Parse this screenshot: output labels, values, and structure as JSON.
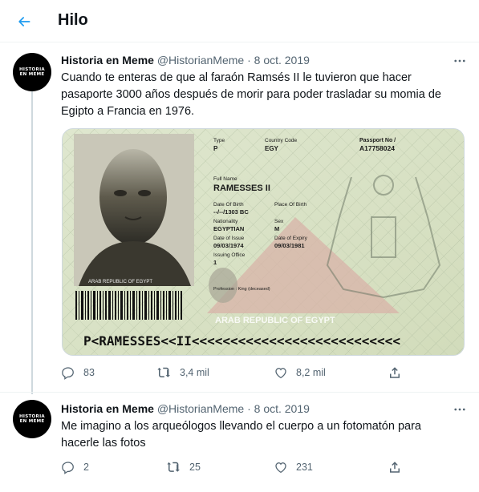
{
  "header": {
    "title": "Hilo"
  },
  "tweets": [
    {
      "name": "Historia en Meme",
      "handle": "@HistorianMeme",
      "sep": "·",
      "date": "8 oct. 2019",
      "text": "Cuando te enteras de que al faraón Ramsés II le tuvieron que hacer pasaporte 3000 años después de morir para poder trasladar su momia de Egipto a Francia en 1976.",
      "avatar_line1": "HISTORIA",
      "avatar_line2": "EN MEME",
      "replies": "83",
      "retweets": "3,4 mil",
      "likes": "8,2 mil"
    },
    {
      "name": "Historia en Meme",
      "handle": "@HistorianMeme",
      "sep": "·",
      "date": "8 oct. 2019",
      "text": "Me imagino a los arqueólogos llevando el cuerpo a un fotomatón para hacerle las fotos",
      "avatar_line1": "HISTORIA",
      "avatar_line2": "EN MEME",
      "replies": "2",
      "retweets": "25",
      "likes": "231"
    }
  ],
  "passport": {
    "type_label": "Type",
    "type_value": "P",
    "country_label": "Country Code",
    "country_value": "EGY",
    "passport_no_label": "Passport No /",
    "passport_no_value": "A17758024",
    "full_name_label": "Full Name",
    "full_name_value": "RAMESSES II",
    "dob_label": "Date Of Birth",
    "dob_value": "--/--/1303 BC",
    "pob_label": "Place Of Birth",
    "nationality_label": "Nationality",
    "nationality_value": "EGYPTIAN",
    "sex_label": "Sex",
    "sex_value": "M",
    "doi_label": "Date of Issue",
    "doi_value": "09/03/1974",
    "doe_label": "Date of Expiry",
    "doe_value": "09/03/1981",
    "issuing_label": "Issuing Office",
    "issuing_value": "1",
    "profession": "Profession : King (deceased)",
    "photo_caption": "ARAB REPUBLIC OF EGYPT",
    "footer_text": "ARAB REPUBLIC OF EGYPT",
    "mrz_line": "P<RAMESSES<<II<<<<<<<<<<<<<<<<<<<<<<<<<<<"
  },
  "colors": {
    "accent": "#1d9bf0",
    "muted": "#536471",
    "text": "#0f1419"
  },
  "icons": [
    "back-arrow-icon",
    "more-icon",
    "reply-icon",
    "retweet-icon",
    "like-icon",
    "share-icon"
  ]
}
